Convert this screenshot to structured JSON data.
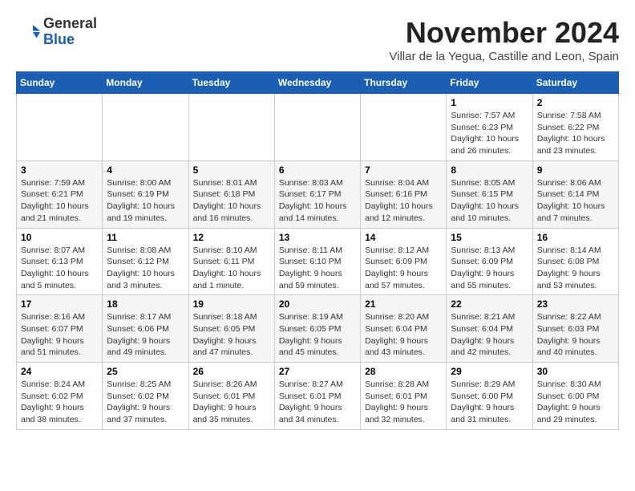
{
  "logo": {
    "line1": "General",
    "line2": "Blue"
  },
  "header": {
    "month": "November 2024",
    "location": "Villar de la Yegua, Castille and Leon, Spain"
  },
  "weekdays": [
    "Sunday",
    "Monday",
    "Tuesday",
    "Wednesday",
    "Thursday",
    "Friday",
    "Saturday"
  ],
  "weeks": [
    [
      {
        "day": "",
        "info": ""
      },
      {
        "day": "",
        "info": ""
      },
      {
        "day": "",
        "info": ""
      },
      {
        "day": "",
        "info": ""
      },
      {
        "day": "",
        "info": ""
      },
      {
        "day": "1",
        "info": "Sunrise: 7:57 AM\nSunset: 6:23 PM\nDaylight: 10 hours\nand 26 minutes."
      },
      {
        "day": "2",
        "info": "Sunrise: 7:58 AM\nSunset: 6:22 PM\nDaylight: 10 hours\nand 23 minutes."
      }
    ],
    [
      {
        "day": "3",
        "info": "Sunrise: 7:59 AM\nSunset: 6:21 PM\nDaylight: 10 hours\nand 21 minutes."
      },
      {
        "day": "4",
        "info": "Sunrise: 8:00 AM\nSunset: 6:19 PM\nDaylight: 10 hours\nand 19 minutes."
      },
      {
        "day": "5",
        "info": "Sunrise: 8:01 AM\nSunset: 6:18 PM\nDaylight: 10 hours\nand 16 minutes."
      },
      {
        "day": "6",
        "info": "Sunrise: 8:03 AM\nSunset: 6:17 PM\nDaylight: 10 hours\nand 14 minutes."
      },
      {
        "day": "7",
        "info": "Sunrise: 8:04 AM\nSunset: 6:16 PM\nDaylight: 10 hours\nand 12 minutes."
      },
      {
        "day": "8",
        "info": "Sunrise: 8:05 AM\nSunset: 6:15 PM\nDaylight: 10 hours\nand 10 minutes."
      },
      {
        "day": "9",
        "info": "Sunrise: 8:06 AM\nSunset: 6:14 PM\nDaylight: 10 hours\nand 7 minutes."
      }
    ],
    [
      {
        "day": "10",
        "info": "Sunrise: 8:07 AM\nSunset: 6:13 PM\nDaylight: 10 hours\nand 5 minutes."
      },
      {
        "day": "11",
        "info": "Sunrise: 8:08 AM\nSunset: 6:12 PM\nDaylight: 10 hours\nand 3 minutes."
      },
      {
        "day": "12",
        "info": "Sunrise: 8:10 AM\nSunset: 6:11 PM\nDaylight: 10 hours\nand 1 minute."
      },
      {
        "day": "13",
        "info": "Sunrise: 8:11 AM\nSunset: 6:10 PM\nDaylight: 9 hours\nand 59 minutes."
      },
      {
        "day": "14",
        "info": "Sunrise: 8:12 AM\nSunset: 6:09 PM\nDaylight: 9 hours\nand 57 minutes."
      },
      {
        "day": "15",
        "info": "Sunrise: 8:13 AM\nSunset: 6:09 PM\nDaylight: 9 hours\nand 55 minutes."
      },
      {
        "day": "16",
        "info": "Sunrise: 8:14 AM\nSunset: 6:08 PM\nDaylight: 9 hours\nand 53 minutes."
      }
    ],
    [
      {
        "day": "17",
        "info": "Sunrise: 8:16 AM\nSunset: 6:07 PM\nDaylight: 9 hours\nand 51 minutes."
      },
      {
        "day": "18",
        "info": "Sunrise: 8:17 AM\nSunset: 6:06 PM\nDaylight: 9 hours\nand 49 minutes."
      },
      {
        "day": "19",
        "info": "Sunrise: 8:18 AM\nSunset: 6:05 PM\nDaylight: 9 hours\nand 47 minutes."
      },
      {
        "day": "20",
        "info": "Sunrise: 8:19 AM\nSunset: 6:05 PM\nDaylight: 9 hours\nand 45 minutes."
      },
      {
        "day": "21",
        "info": "Sunrise: 8:20 AM\nSunset: 6:04 PM\nDaylight: 9 hours\nand 43 minutes."
      },
      {
        "day": "22",
        "info": "Sunrise: 8:21 AM\nSunset: 6:04 PM\nDaylight: 9 hours\nand 42 minutes."
      },
      {
        "day": "23",
        "info": "Sunrise: 8:22 AM\nSunset: 6:03 PM\nDaylight: 9 hours\nand 40 minutes."
      }
    ],
    [
      {
        "day": "24",
        "info": "Sunrise: 8:24 AM\nSunset: 6:02 PM\nDaylight: 9 hours\nand 38 minutes."
      },
      {
        "day": "25",
        "info": "Sunrise: 8:25 AM\nSunset: 6:02 PM\nDaylight: 9 hours\nand 37 minutes."
      },
      {
        "day": "26",
        "info": "Sunrise: 8:26 AM\nSunset: 6:01 PM\nDaylight: 9 hours\nand 35 minutes."
      },
      {
        "day": "27",
        "info": "Sunrise: 8:27 AM\nSunset: 6:01 PM\nDaylight: 9 hours\nand 34 minutes."
      },
      {
        "day": "28",
        "info": "Sunrise: 8:28 AM\nSunset: 6:01 PM\nDaylight: 9 hours\nand 32 minutes."
      },
      {
        "day": "29",
        "info": "Sunrise: 8:29 AM\nSunset: 6:00 PM\nDaylight: 9 hours\nand 31 minutes."
      },
      {
        "day": "30",
        "info": "Sunrise: 8:30 AM\nSunset: 6:00 PM\nDaylight: 9 hours\nand 29 minutes."
      }
    ]
  ]
}
